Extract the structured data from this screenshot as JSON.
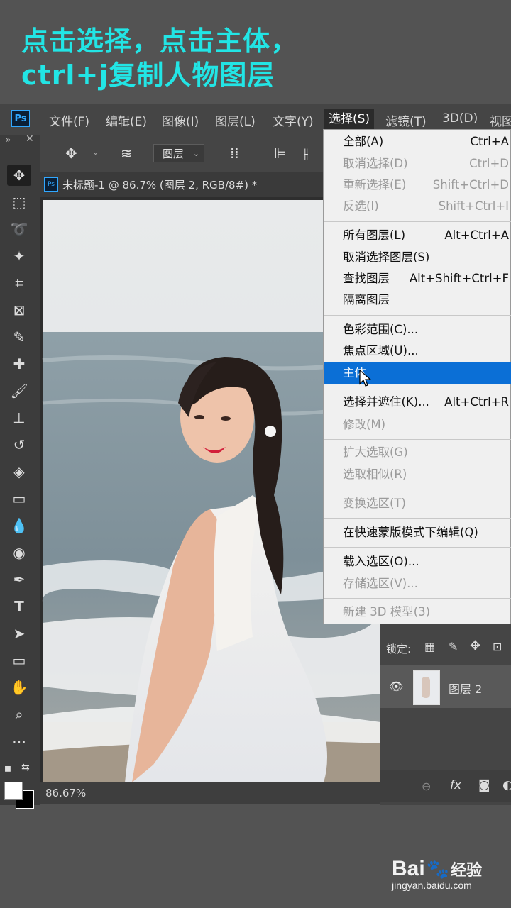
{
  "caption": {
    "line1": "点击选择，点击主体，",
    "line2": "ctrl+j复制人物图层"
  },
  "menubar": {
    "logo": "Ps",
    "items": [
      "文件(F)",
      "编辑(E)",
      "图像(I)",
      "图层(L)",
      "文字(Y)",
      "选择(S)",
      "滤镜(T)",
      "3D(D)",
      "视图"
    ],
    "active": "选择(S)"
  },
  "options_bar": {
    "layer_select": "图层"
  },
  "document": {
    "tab_title": "未标题-1 @ 86.7% (图层 2, RGB/8#) *",
    "zoom": "86.67%"
  },
  "select_menu": {
    "items": [
      {
        "label": "全部(A)",
        "shortcut": "Ctrl+A",
        "disabled": false
      },
      {
        "label": "取消选择(D)",
        "shortcut": "Ctrl+D",
        "disabled": true
      },
      {
        "label": "重新选择(E)",
        "shortcut": "Shift+Ctrl+D",
        "disabled": true
      },
      {
        "label": "反选(I)",
        "shortcut": "Shift+Ctrl+I",
        "disabled": true
      },
      {
        "label": "所有图层(L)",
        "shortcut": "Alt+Ctrl+A",
        "disabled": false
      },
      {
        "label": "取消选择图层(S)",
        "shortcut": "",
        "disabled": false
      },
      {
        "label": "查找图层",
        "shortcut": "Alt+Shift+Ctrl+F",
        "disabled": false
      },
      {
        "label": "隔离图层",
        "shortcut": "",
        "disabled": false
      },
      {
        "label": "色彩范围(C)...",
        "shortcut": "",
        "disabled": false
      },
      {
        "label": "焦点区域(U)...",
        "shortcut": "",
        "disabled": false
      },
      {
        "label": "主体",
        "shortcut": "",
        "disabled": false,
        "highlighted": true
      },
      {
        "label": "选择并遮住(K)...",
        "shortcut": "Alt+Ctrl+R",
        "disabled": false
      },
      {
        "label": "修改(M)",
        "shortcut": "",
        "disabled": true
      },
      {
        "label": "扩大选取(G)",
        "shortcut": "",
        "disabled": true
      },
      {
        "label": "选取相似(R)",
        "shortcut": "",
        "disabled": true
      },
      {
        "label": "变换选区(T)",
        "shortcut": "",
        "disabled": true
      },
      {
        "label": "在快速蒙版模式下编辑(Q)",
        "shortcut": "",
        "disabled": false
      },
      {
        "label": "载入选区(O)...",
        "shortcut": "",
        "disabled": false
      },
      {
        "label": "存储选区(V)...",
        "shortcut": "",
        "disabled": true
      },
      {
        "label": "新建 3D 模型(3)",
        "shortcut": "",
        "disabled": true
      }
    ]
  },
  "layers_panel": {
    "lock_label": "锁定:",
    "layer_name": "图层 2"
  },
  "watermark": {
    "brand": "Bai",
    "brand2": "经验",
    "url": "jingyan.baidu.com"
  },
  "colors": {
    "caption": "#22e5e5",
    "highlight": "#0b6fd6",
    "ps_blue": "#31a8ff"
  }
}
